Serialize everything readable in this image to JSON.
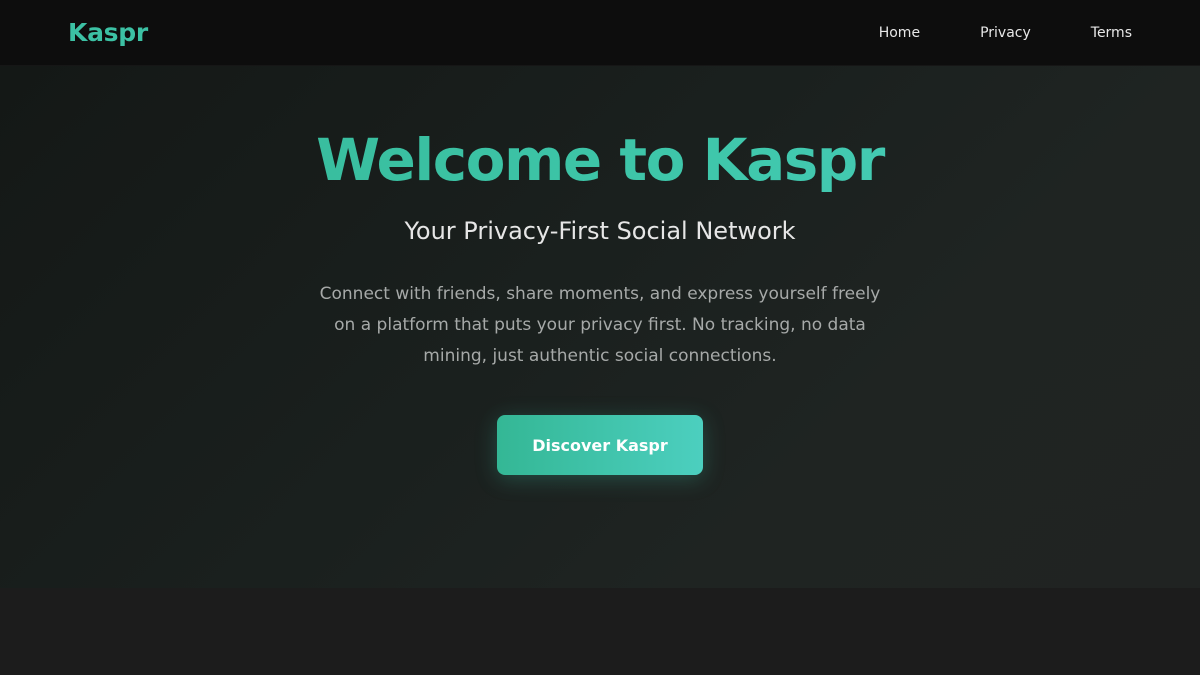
{
  "header": {
    "logo": "Kaspr",
    "nav": [
      {
        "label": "Home"
      },
      {
        "label": "Privacy"
      },
      {
        "label": "Terms"
      }
    ]
  },
  "hero": {
    "title": "Welcome to Kaspr",
    "subtitle": "Your Privacy-First Social Network",
    "description": "Connect with friends, share moments, and express yourself freely on a platform that puts your privacy first. No tracking, no data mining, just authentic social connections.",
    "cta_label": "Discover Kaspr"
  },
  "colors": {
    "accent": "#3cc1a4",
    "accent_light": "#4ccfbf",
    "nav_background": "#0d0d0d",
    "page_background": "#1c1c1c"
  }
}
